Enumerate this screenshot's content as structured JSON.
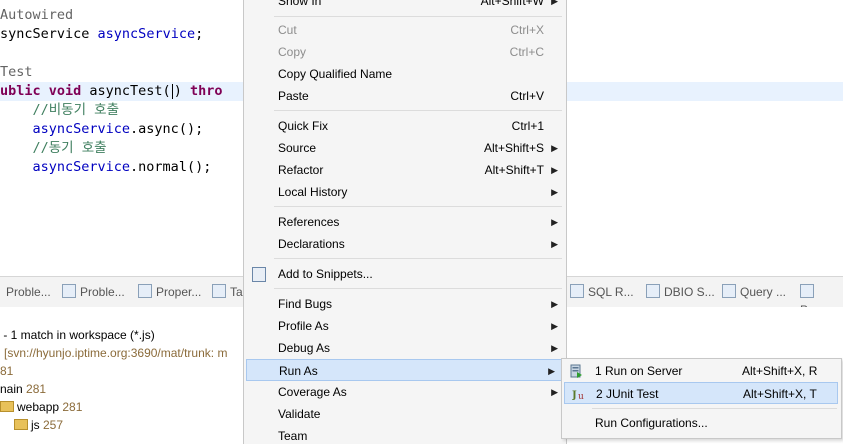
{
  "editor": {
    "line1": "Autowired",
    "line2_type": "syncService ",
    "line2_var": "asyncService",
    "line2_end": ";",
    "line3": "Test",
    "line4_kw1": "ublic void",
    "line4_mid": " asyncTest(",
    "line4_mid2": ") ",
    "line4_kw2": "thro",
    "line5": "    //비동기 호출",
    "line6_var": "    asyncService",
    "line6_rest": ".async();",
    "line7": "    //동기 호출",
    "line8_var": "    asyncService",
    "line8_rest": ".normal();"
  },
  "tabs": [
    {
      "label": "Proble..."
    },
    {
      "label": "Proble..."
    },
    {
      "label": "Proper..."
    },
    {
      "label": "Ta"
    },
    {
      "label": "SQL R..."
    },
    {
      "label": "DBIO S..."
    },
    {
      "label": "Query ..."
    },
    {
      "label": "Prog"
    }
  ],
  "search": {
    "summary": " - 1 match in workspace (*.js)",
    "svn": "[svn://hyunjo.iptime.org:3690/mat/trunk: m",
    "r1": "81",
    "r2_label": "nain",
    "r2_count": " 281",
    "r3_label": "webapp",
    "r3_count": " 281",
    "r4_label": "js",
    "r4_count": " 257"
  },
  "menu": {
    "show_in": "Show In",
    "show_in_acc": "Alt+Shift+W",
    "cut": "Cut",
    "cut_acc": "Ctrl+X",
    "copy": "Copy",
    "copy_acc": "Ctrl+C",
    "copy_qualified": "Copy Qualified Name",
    "paste": "Paste",
    "paste_acc": "Ctrl+V",
    "quick_fix": "Quick Fix",
    "quick_fix_acc": "Ctrl+1",
    "source": "Source",
    "source_acc": "Alt+Shift+S",
    "refactor": "Refactor",
    "refactor_acc": "Alt+Shift+T",
    "local_history": "Local History",
    "references": "References",
    "declarations": "Declarations",
    "add_snippets": "Add to Snippets...",
    "find_bugs": "Find Bugs",
    "profile_as": "Profile As",
    "debug_as": "Debug As",
    "run_as": "Run As",
    "coverage_as": "Coverage As",
    "validate": "Validate",
    "team": "Team"
  },
  "submenu": {
    "run_server": "1 Run on Server",
    "run_server_acc": "Alt+Shift+X, R",
    "junit": "2 JUnit Test",
    "junit_acc": "Alt+Shift+X, T",
    "run_configs": "Run Configurations..."
  },
  "colors": {
    "menu_highlight": "#d5e6fa",
    "keyword": "#7f0055",
    "field": "#0000c0",
    "comment": "#3f7f5f"
  }
}
